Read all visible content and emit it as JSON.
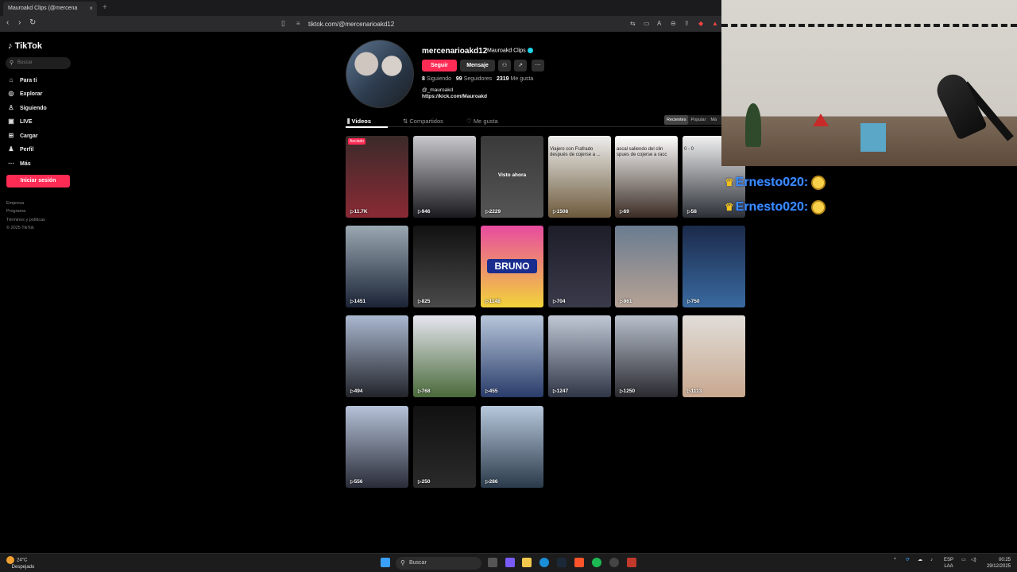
{
  "browser": {
    "tab_title": "Mauroakd Clips (@mercena",
    "tab_close": "×",
    "new_tab": "+",
    "url": "tiktok.com/@mercenarioakd12"
  },
  "sidebar": {
    "logo": "TikTok",
    "search_placeholder": "Buscar",
    "items": [
      {
        "label": "Para ti",
        "icon": "⌂"
      },
      {
        "label": "Explorar",
        "icon": "◎"
      },
      {
        "label": "Siguiendo",
        "icon": "♙"
      },
      {
        "label": "LIVE",
        "icon": "▣"
      },
      {
        "label": "Cargar",
        "icon": "⊞"
      },
      {
        "label": "Perfil",
        "icon": "♟"
      },
      {
        "label": "Más",
        "icon": "⋯"
      }
    ],
    "login": "Iniciar sesión",
    "footer": [
      "Empresa",
      "Programa",
      "Términos y políticas",
      "© 2025 TikTok"
    ]
  },
  "profile": {
    "username": "mercenarioakd12",
    "display_name": "Mauroakd Clips",
    "follow": "Seguir",
    "message": "Mensaje",
    "following_count": "8",
    "following_label": "Siguiendo",
    "followers_count": "99",
    "followers_label": "Seguidores",
    "likes_count": "2319",
    "likes_label": "Me gusta",
    "handle": "@_mauroakd",
    "link": "https://kick.com/Mauroakd"
  },
  "tabs": {
    "videos": "Videos",
    "shared": "Compartidos",
    "liked": "Me gusta",
    "sort": [
      "Recientes",
      "Popular",
      "Má"
    ]
  },
  "videos": [
    {
      "views": "11.7K",
      "pinned": "Anclado",
      "c1": "#3b2a2a",
      "c2": "#8a2a35"
    },
    {
      "views": "946",
      "c1": "#c8c8cc",
      "c2": "#1a1a1e"
    },
    {
      "views": "2229",
      "seen": "Visto ahora",
      "c1": "#3a3a3a",
      "c2": "#555"
    },
    {
      "views": "1508",
      "text": "Viajero con Frafrado después de cojerse a ...",
      "c1": "#eee",
      "c2": "#6d5a3b"
    },
    {
      "views": "69",
      "text": "ascal saliendo del clin spues de cojerse a racc",
      "c1": "#fff",
      "c2": "#3a2c24"
    },
    {
      "views": "58",
      "text": "0 - 0",
      "c1": "#f2f2f2",
      "c2": "#2b2f36"
    },
    {
      "views": "1451",
      "c1": "#9aa8b2",
      "c2": "#1b2436"
    },
    {
      "views": "825",
      "c1": "#111",
      "c2": "#4a4a4a"
    },
    {
      "views": "1148",
      "bruno": "BRUNO",
      "c1": "#e84aa0",
      "c2": "#f2d43a"
    },
    {
      "views": "704",
      "c1": "#1e1e2a",
      "c2": "#3a3a4a"
    },
    {
      "views": "961",
      "c1": "#6a7c90",
      "c2": "#b6a295"
    },
    {
      "views": "750",
      "c1": "#1b2a4a",
      "c2": "#3a6aa0"
    },
    {
      "views": "494",
      "c1": "#aab8d0",
      "c2": "#22242a"
    },
    {
      "views": "768",
      "c1": "#e6e6f0",
      "c2": "#4a6a3a"
    },
    {
      "views": "455",
      "c1": "#b7c6da",
      "c2": "#2a3c6a"
    },
    {
      "views": "1247",
      "c1": "#c0c8d6",
      "c2": "#303646"
    },
    {
      "views": "1250",
      "c1": "#b8c0cc",
      "c2": "#2a2a30"
    },
    {
      "views": "1113",
      "c1": "#e0ddd8",
      "c2": "#c8a890"
    },
    {
      "views": "556",
      "c1": "#b5c2d8",
      "c2": "#2a2c38"
    },
    {
      "views": "250",
      "c1": "#111",
      "c2": "#2a2a2a"
    },
    {
      "views": "286",
      "c1": "#b8c8dc",
      "c2": "#2a3a4a"
    }
  ],
  "chat": [
    {
      "user": "Ernesto020:"
    },
    {
      "user": "Ernesto020:"
    }
  ],
  "taskbar": {
    "temp": "24°C",
    "weather": "Despejado",
    "search": "Buscar",
    "lang1": "ESP",
    "lang2": "LAA",
    "time": "00:25",
    "date": "29/12/2025"
  }
}
